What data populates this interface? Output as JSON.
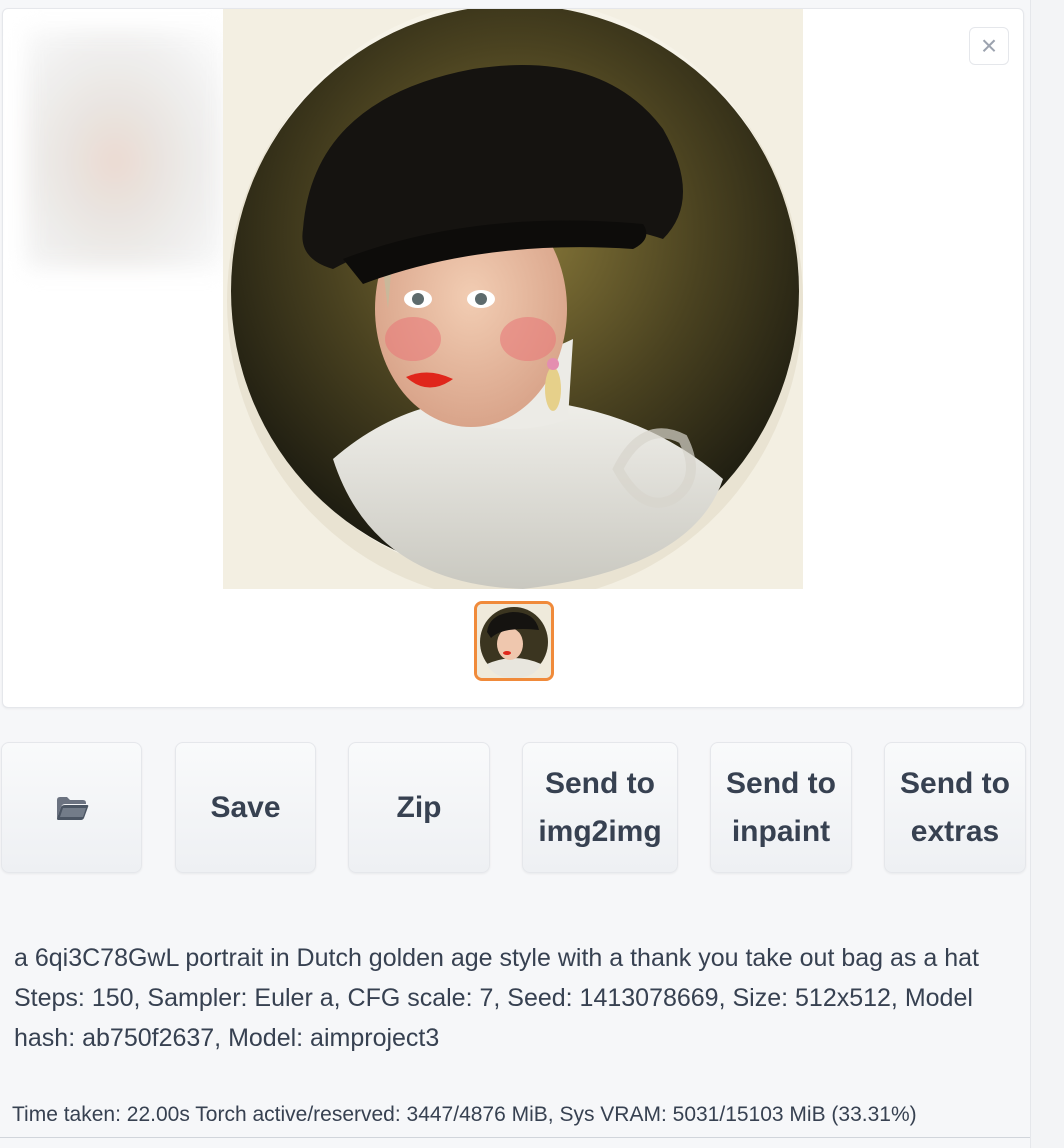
{
  "gallery": {
    "close_label": "×",
    "main_image_icon": "portrait-image",
    "selected_thumbnail_icon": "portrait-thumbnail"
  },
  "toolbar": {
    "buttons": [
      {
        "id": "open-folder",
        "label": "",
        "icon": "folder-icon"
      },
      {
        "id": "save",
        "label": "Save"
      },
      {
        "id": "zip",
        "label": "Zip"
      },
      {
        "id": "send-img2img",
        "label": "Send to\nimg2img"
      },
      {
        "id": "send-inpaint",
        "label": "Send to\ninpaint"
      },
      {
        "id": "send-extras",
        "label": "Send to\nextras"
      }
    ]
  },
  "generation_info": {
    "prompt": "a 6qi3C78GwL portrait in Dutch golden age style with a thank you take out bag as a hat",
    "params": "Steps: 150, Sampler: Euler a, CFG scale: 7, Seed: 1413078669, Size: 512x512, Model hash: ab750f2637, Model: aimproject3"
  },
  "performance": {
    "text": "Time taken: 22.00s  Torch active/reserved: 3447/4876 MiB, Sys VRAM: 5031/15103 MiB (33.31%)"
  },
  "colors": {
    "selected_border": "#f08a3a",
    "background": "#f6f7f9"
  }
}
